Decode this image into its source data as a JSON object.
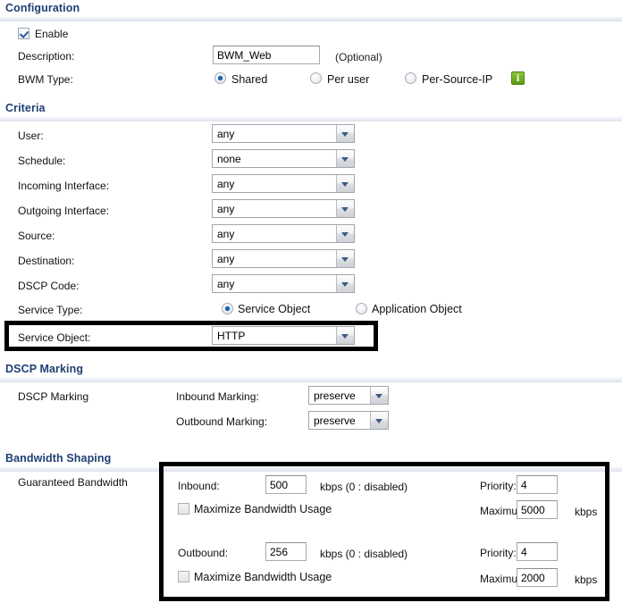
{
  "sections": {
    "configuration": "Configuration",
    "criteria": "Criteria",
    "dscp_marking": "DSCP Marking",
    "bandwidth_shaping": "Bandwidth Shaping"
  },
  "configuration": {
    "enable_label": "Enable",
    "enable_checked": true,
    "description_label": "Description:",
    "description_value": "BWM_Web",
    "optional_note": "(Optional)",
    "bwm_type_label": "BWM Type:",
    "bwm_type_options": [
      "Shared",
      "Per user",
      "Per-Source-IP"
    ],
    "bwm_type_selected": "Shared",
    "info_icon": "info-icon"
  },
  "criteria": {
    "rows": [
      {
        "label": "User:",
        "value": "any"
      },
      {
        "label": "Schedule:",
        "value": "none"
      },
      {
        "label": "Incoming Interface:",
        "value": "any"
      },
      {
        "label": "Outgoing Interface:",
        "value": "any"
      },
      {
        "label": "Source:",
        "value": "any"
      },
      {
        "label": "Destination:",
        "value": "any"
      },
      {
        "label": "DSCP Code:",
        "value": "any"
      }
    ],
    "service_type_label": "Service Type:",
    "service_type_options": [
      "Service Object",
      "Application Object"
    ],
    "service_type_selected": "Service Object",
    "service_object_label": "Service Object:",
    "service_object_value": "HTTP"
  },
  "dscp": {
    "row_label": "DSCP Marking",
    "inbound_label": "Inbound Marking:",
    "inbound_value": "preserve",
    "outbound_label": "Outbound Marking:",
    "outbound_value": "preserve"
  },
  "bandwidth": {
    "row_label": "Guaranteed Bandwidth",
    "inbound_label": "Inbound:",
    "inbound_value": "500",
    "inbound_unit": "kbps (0 : disabled)",
    "inbound_maximize_label": "Maximize Bandwidth Usage",
    "inbound_maximize_checked": false,
    "inbound_priority_label": "Priority:",
    "inbound_priority_value": "4",
    "inbound_maximum_label": "Maximum:",
    "inbound_maximum_value": "5000",
    "inbound_maximum_unit": "kbps",
    "outbound_label": "Outbound:",
    "outbound_value": "256",
    "outbound_unit": "kbps (0 : disabled)",
    "outbound_maximize_label": "Maximize Bandwidth Usage",
    "outbound_maximize_checked": false,
    "outbound_priority_label": "Priority:",
    "outbound_priority_value": "4",
    "outbound_maximum_label": "Maximum:",
    "outbound_maximum_value": "2000",
    "outbound_maximum_unit": "kbps"
  },
  "colors": {
    "section_title": "#1F3F73",
    "highlight_box": "#000000",
    "radio_dot": "#1463B8",
    "info_green": "#6FAE22"
  }
}
